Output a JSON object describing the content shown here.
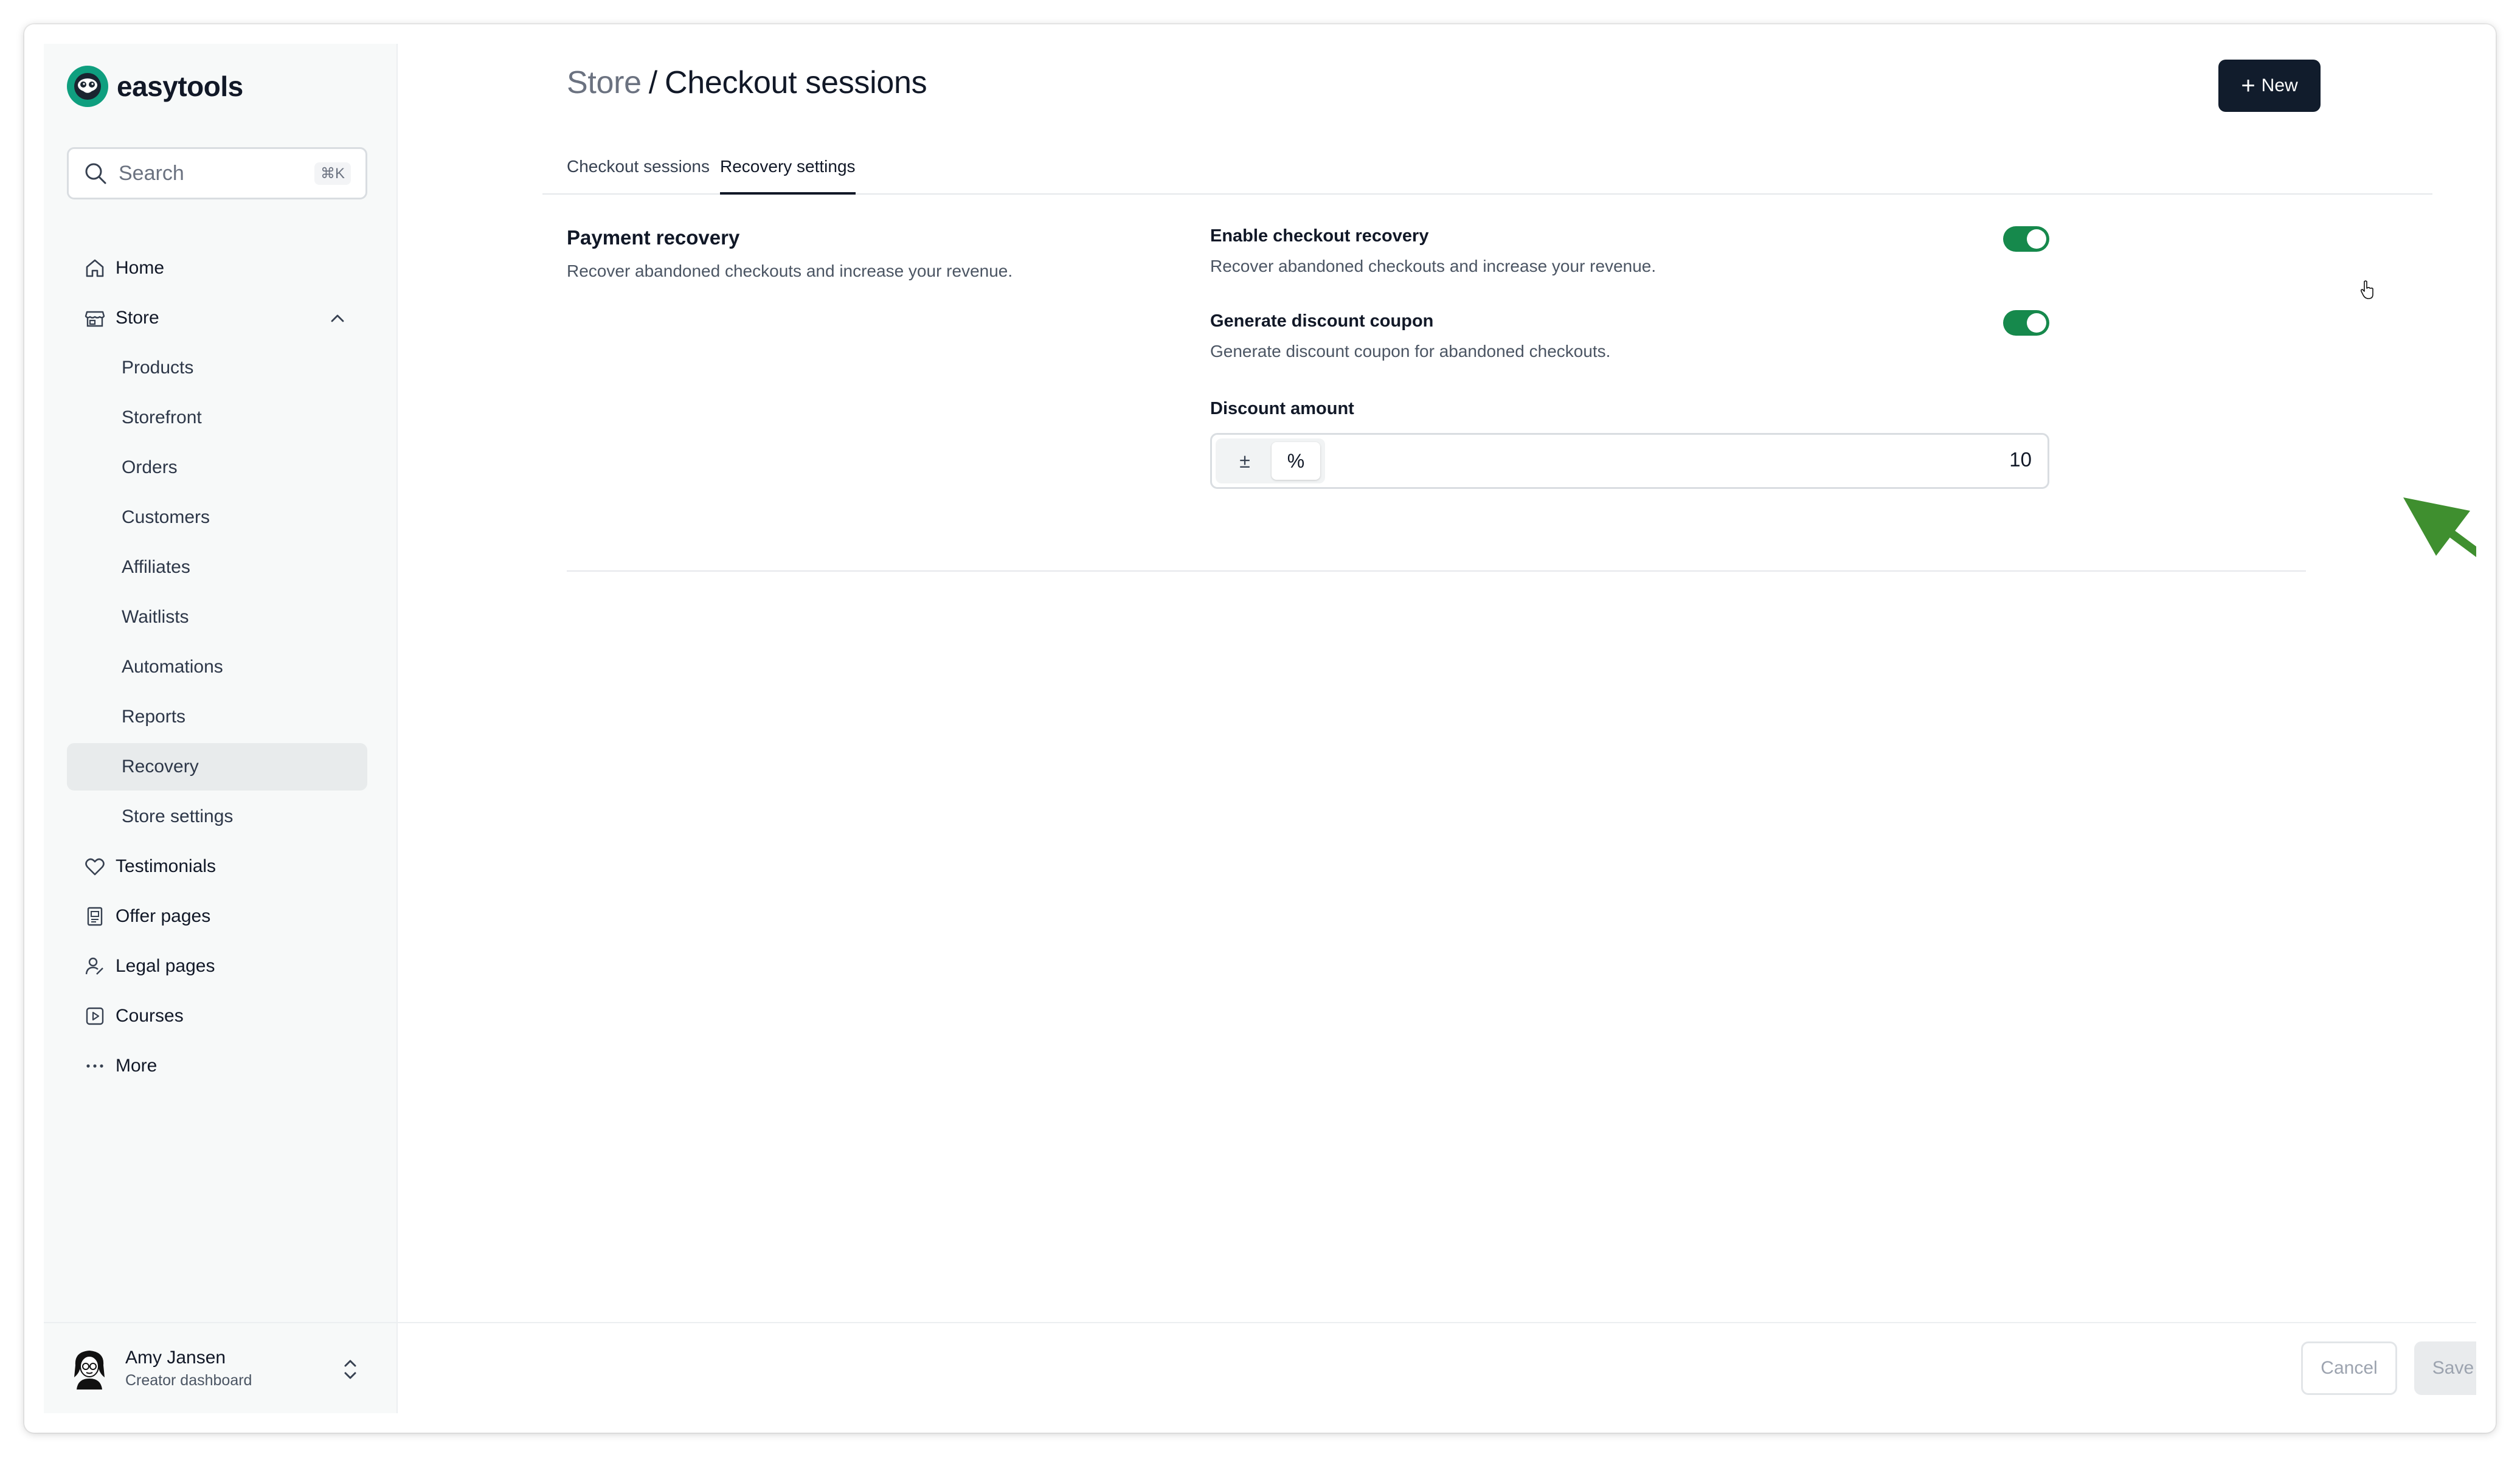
{
  "brand": {
    "name": "easytools"
  },
  "search": {
    "placeholder": "Search",
    "shortcut": "⌘K"
  },
  "sidebar": {
    "items": [
      {
        "label": "Home",
        "icon": "home-icon"
      },
      {
        "label": "Store",
        "icon": "store-icon",
        "expanded": true
      },
      {
        "label": "Products"
      },
      {
        "label": "Storefront"
      },
      {
        "label": "Orders"
      },
      {
        "label": "Customers"
      },
      {
        "label": "Affiliates"
      },
      {
        "label": "Waitlists"
      },
      {
        "label": "Automations"
      },
      {
        "label": "Reports"
      },
      {
        "label": "Recovery",
        "active": true
      },
      {
        "label": "Store settings"
      },
      {
        "label": "Testimonials",
        "icon": "heart-icon"
      },
      {
        "label": "Offer pages",
        "icon": "offer-page-icon"
      },
      {
        "label": "Legal pages",
        "icon": "legal-icon"
      },
      {
        "label": "Courses",
        "icon": "courses-icon"
      },
      {
        "label": "More",
        "icon": "more-icon"
      }
    ]
  },
  "user": {
    "name": "Amy Jansen",
    "role": "Creator dashboard"
  },
  "header": {
    "breadcrumb_parent": "Store",
    "separator": "/",
    "title": "Checkout sessions",
    "new_button": "New"
  },
  "tabs": [
    {
      "label": "Checkout sessions",
      "active": false
    },
    {
      "label": "Recovery settings",
      "active": true
    }
  ],
  "section": {
    "title": "Payment recovery",
    "description": "Recover abandoned checkouts and increase your revenue."
  },
  "settings": {
    "checkout_recovery": {
      "label": "Enable checkout recovery",
      "description": "Recover abandoned checkouts and increase your revenue.",
      "enabled": true
    },
    "discount_coupon": {
      "label": "Generate discount coupon",
      "description": "Generate discount coupon for abandoned checkouts.",
      "enabled": true
    },
    "discount_amount": {
      "label": "Discount amount",
      "options": [
        "±",
        "%"
      ],
      "selected": "%",
      "value": "10"
    }
  },
  "footer": {
    "cancel": "Cancel",
    "save": "Save"
  },
  "colors": {
    "toggle_on": "#16894c",
    "primary_button": "#111c2c",
    "annotation_arrow": "#3f8f2f",
    "brand_logo": "#0f9f7f"
  }
}
